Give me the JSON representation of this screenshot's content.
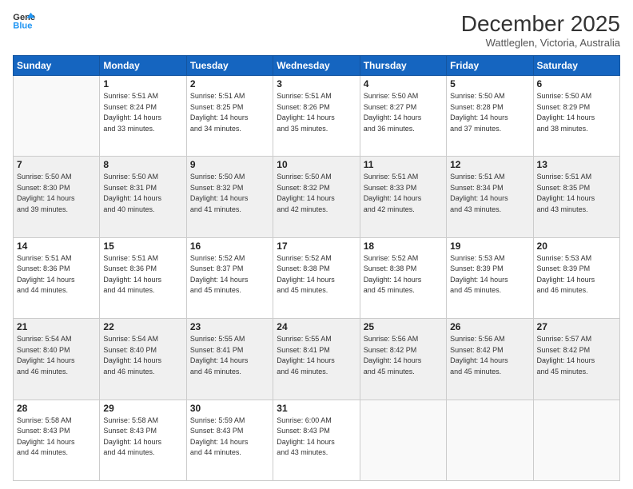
{
  "logo": {
    "line1": "General",
    "line2": "Blue"
  },
  "title": "December 2025",
  "location": "Wattleglen, Victoria, Australia",
  "days_header": [
    "Sunday",
    "Monday",
    "Tuesday",
    "Wednesday",
    "Thursday",
    "Friday",
    "Saturday"
  ],
  "weeks": [
    [
      {
        "day": "",
        "sunrise": "",
        "sunset": "",
        "daylight": ""
      },
      {
        "day": "1",
        "sunrise": "Sunrise: 5:51 AM",
        "sunset": "Sunset: 8:24 PM",
        "daylight": "Daylight: 14 hours and 33 minutes."
      },
      {
        "day": "2",
        "sunrise": "Sunrise: 5:51 AM",
        "sunset": "Sunset: 8:25 PM",
        "daylight": "Daylight: 14 hours and 34 minutes."
      },
      {
        "day": "3",
        "sunrise": "Sunrise: 5:51 AM",
        "sunset": "Sunset: 8:26 PM",
        "daylight": "Daylight: 14 hours and 35 minutes."
      },
      {
        "day": "4",
        "sunrise": "Sunrise: 5:50 AM",
        "sunset": "Sunset: 8:27 PM",
        "daylight": "Daylight: 14 hours and 36 minutes."
      },
      {
        "day": "5",
        "sunrise": "Sunrise: 5:50 AM",
        "sunset": "Sunset: 8:28 PM",
        "daylight": "Daylight: 14 hours and 37 minutes."
      },
      {
        "day": "6",
        "sunrise": "Sunrise: 5:50 AM",
        "sunset": "Sunset: 8:29 PM",
        "daylight": "Daylight: 14 hours and 38 minutes."
      }
    ],
    [
      {
        "day": "7",
        "sunrise": "Sunrise: 5:50 AM",
        "sunset": "Sunset: 8:30 PM",
        "daylight": "Daylight: 14 hours and 39 minutes."
      },
      {
        "day": "8",
        "sunrise": "Sunrise: 5:50 AM",
        "sunset": "Sunset: 8:31 PM",
        "daylight": "Daylight: 14 hours and 40 minutes."
      },
      {
        "day": "9",
        "sunrise": "Sunrise: 5:50 AM",
        "sunset": "Sunset: 8:32 PM",
        "daylight": "Daylight: 14 hours and 41 minutes."
      },
      {
        "day": "10",
        "sunrise": "Sunrise: 5:50 AM",
        "sunset": "Sunset: 8:32 PM",
        "daylight": "Daylight: 14 hours and 42 minutes."
      },
      {
        "day": "11",
        "sunrise": "Sunrise: 5:51 AM",
        "sunset": "Sunset: 8:33 PM",
        "daylight": "Daylight: 14 hours and 42 minutes."
      },
      {
        "day": "12",
        "sunrise": "Sunrise: 5:51 AM",
        "sunset": "Sunset: 8:34 PM",
        "daylight": "Daylight: 14 hours and 43 minutes."
      },
      {
        "day": "13",
        "sunrise": "Sunrise: 5:51 AM",
        "sunset": "Sunset: 8:35 PM",
        "daylight": "Daylight: 14 hours and 43 minutes."
      }
    ],
    [
      {
        "day": "14",
        "sunrise": "Sunrise: 5:51 AM",
        "sunset": "Sunset: 8:36 PM",
        "daylight": "Daylight: 14 hours and 44 minutes."
      },
      {
        "day": "15",
        "sunrise": "Sunrise: 5:51 AM",
        "sunset": "Sunset: 8:36 PM",
        "daylight": "Daylight: 14 hours and 44 minutes."
      },
      {
        "day": "16",
        "sunrise": "Sunrise: 5:52 AM",
        "sunset": "Sunset: 8:37 PM",
        "daylight": "Daylight: 14 hours and 45 minutes."
      },
      {
        "day": "17",
        "sunrise": "Sunrise: 5:52 AM",
        "sunset": "Sunset: 8:38 PM",
        "daylight": "Daylight: 14 hours and 45 minutes."
      },
      {
        "day": "18",
        "sunrise": "Sunrise: 5:52 AM",
        "sunset": "Sunset: 8:38 PM",
        "daylight": "Daylight: 14 hours and 45 minutes."
      },
      {
        "day": "19",
        "sunrise": "Sunrise: 5:53 AM",
        "sunset": "Sunset: 8:39 PM",
        "daylight": "Daylight: 14 hours and 45 minutes."
      },
      {
        "day": "20",
        "sunrise": "Sunrise: 5:53 AM",
        "sunset": "Sunset: 8:39 PM",
        "daylight": "Daylight: 14 hours and 46 minutes."
      }
    ],
    [
      {
        "day": "21",
        "sunrise": "Sunrise: 5:54 AM",
        "sunset": "Sunset: 8:40 PM",
        "daylight": "Daylight: 14 hours and 46 minutes."
      },
      {
        "day": "22",
        "sunrise": "Sunrise: 5:54 AM",
        "sunset": "Sunset: 8:40 PM",
        "daylight": "Daylight: 14 hours and 46 minutes."
      },
      {
        "day": "23",
        "sunrise": "Sunrise: 5:55 AM",
        "sunset": "Sunset: 8:41 PM",
        "daylight": "Daylight: 14 hours and 46 minutes."
      },
      {
        "day": "24",
        "sunrise": "Sunrise: 5:55 AM",
        "sunset": "Sunset: 8:41 PM",
        "daylight": "Daylight: 14 hours and 46 minutes."
      },
      {
        "day": "25",
        "sunrise": "Sunrise: 5:56 AM",
        "sunset": "Sunset: 8:42 PM",
        "daylight": "Daylight: 14 hours and 45 minutes."
      },
      {
        "day": "26",
        "sunrise": "Sunrise: 5:56 AM",
        "sunset": "Sunset: 8:42 PM",
        "daylight": "Daylight: 14 hours and 45 minutes."
      },
      {
        "day": "27",
        "sunrise": "Sunrise: 5:57 AM",
        "sunset": "Sunset: 8:42 PM",
        "daylight": "Daylight: 14 hours and 45 minutes."
      }
    ],
    [
      {
        "day": "28",
        "sunrise": "Sunrise: 5:58 AM",
        "sunset": "Sunset: 8:43 PM",
        "daylight": "Daylight: 14 hours and 44 minutes."
      },
      {
        "day": "29",
        "sunrise": "Sunrise: 5:58 AM",
        "sunset": "Sunset: 8:43 PM",
        "daylight": "Daylight: 14 hours and 44 minutes."
      },
      {
        "day": "30",
        "sunrise": "Sunrise: 5:59 AM",
        "sunset": "Sunset: 8:43 PM",
        "daylight": "Daylight: 14 hours and 44 minutes."
      },
      {
        "day": "31",
        "sunrise": "Sunrise: 6:00 AM",
        "sunset": "Sunset: 8:43 PM",
        "daylight": "Daylight: 14 hours and 43 minutes."
      },
      {
        "day": "",
        "sunrise": "",
        "sunset": "",
        "daylight": ""
      },
      {
        "day": "",
        "sunrise": "",
        "sunset": "",
        "daylight": ""
      },
      {
        "day": "",
        "sunrise": "",
        "sunset": "",
        "daylight": ""
      }
    ]
  ]
}
